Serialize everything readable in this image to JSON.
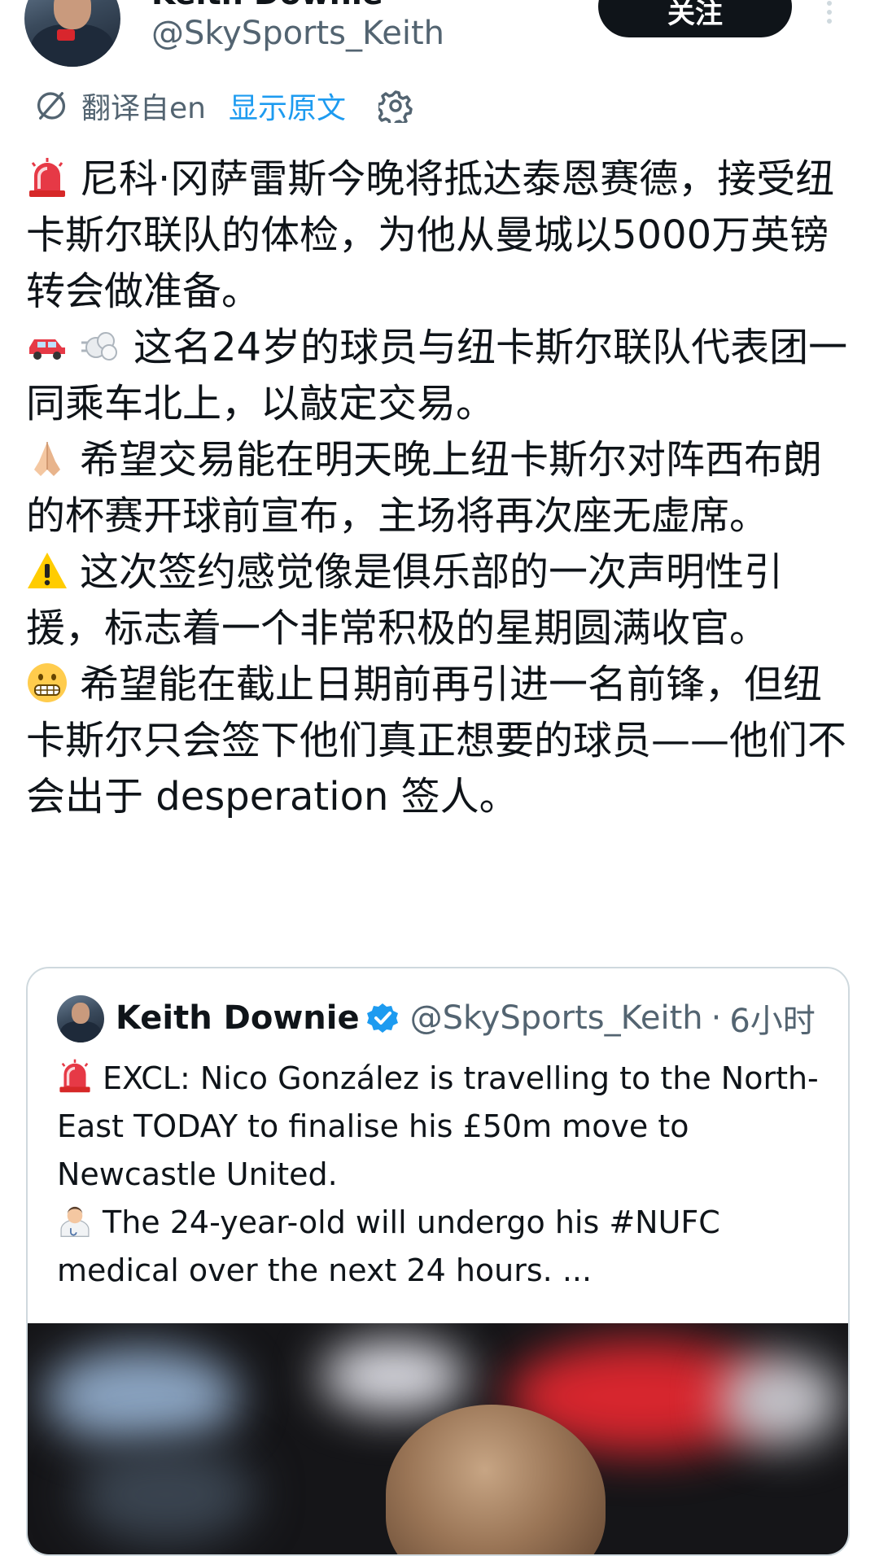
{
  "author": {
    "display_name": "Keith Downie",
    "handle": "@SkySports_Keith",
    "follow_label": "关注"
  },
  "translation": {
    "translated_from": "翻译自en",
    "show_original": "显示原文"
  },
  "post": {
    "paragraphs": [
      {
        "emoji": "police-light-emoji",
        "text": "尼科·冈萨雷斯今晚将抵达泰恩赛德，接受纽卡斯尔联队的体检，为他从曼城以5000万英镑转会做准备。"
      },
      {
        "emoji": "car-and-dash-emoji",
        "text": "这名24岁的球员与纽卡斯尔联队代表团一同乘车北上，以敲定交易。"
      },
      {
        "emoji": "folded-hands-emoji",
        "text": "希望交易能在明天晚上纽卡斯尔对阵西布朗的杯赛开球前宣布，主场将再次座无虚席。"
      },
      {
        "emoji": "warning-emoji",
        "text": "这次签约感觉像是俱乐部的一次声明性引援，标志着一个非常积极的星期圆满收官。"
      },
      {
        "emoji": "grimacing-face-emoji",
        "text": "希望能在截止日期前再引进一名前锋，但纽卡斯尔只会签下他们真正想要的球员——他们不会出于 desperation 签人。"
      }
    ]
  },
  "quoted_post": {
    "display_name": "Keith Downie",
    "handle": "@SkySports_Keith",
    "separator": "·",
    "time": "6小时",
    "paragraphs": [
      {
        "emoji": "police-light-emoji",
        "text": "EXCL: Nico González is travelling to the North-East TODAY to finalise his £50m move to Newcastle United."
      },
      {
        "emoji": "doctor-emoji",
        "text": "The 24-year-old will undergo his #NUFC medical over the next 24 hours. ..."
      }
    ]
  },
  "colors": {
    "text": "#0f1419",
    "secondary": "#536471",
    "link": "#1d9bf0",
    "border": "#cfd9de",
    "verified": "#1d9bf0"
  }
}
